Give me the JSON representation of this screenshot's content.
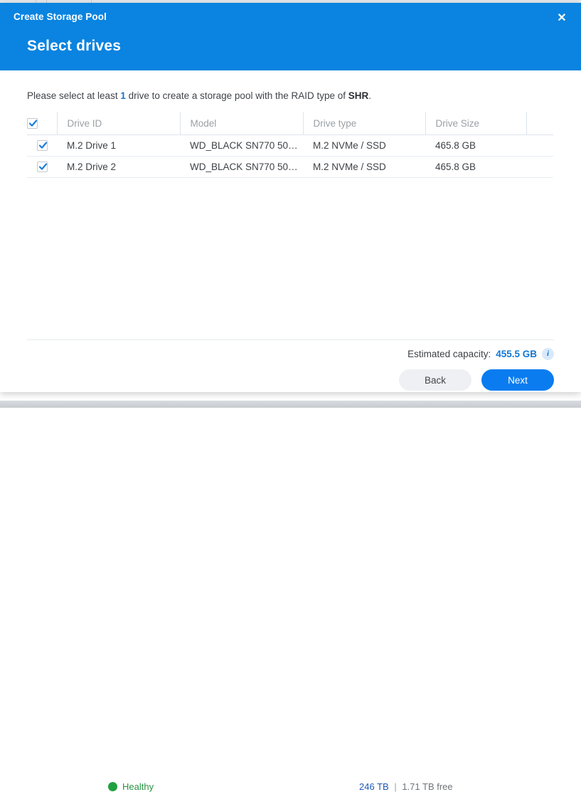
{
  "background": {
    "health_status": "Healthy",
    "capacity_used": "246 TB",
    "capacity_separator": "|",
    "capacity_free": "1.71 TB free"
  },
  "dialog": {
    "title": "Create Storage Pool",
    "subtitle": "Select drives",
    "close_label": "✕",
    "instruction": {
      "prefix": "Please select at least ",
      "min_drives": "1",
      "middle": " drive to create a storage pool with the RAID type of ",
      "raid_type": "SHR",
      "suffix": "."
    },
    "table": {
      "columns": [
        "Drive ID",
        "Model",
        "Drive type",
        "Drive Size"
      ],
      "header_checkbox_checked": true,
      "rows": [
        {
          "checked": true,
          "drive_id": "M.2 Drive 1",
          "model": "WD_BLACK SN770 50…",
          "drive_type": "M.2 NVMe / SSD",
          "drive_size": "465.8 GB"
        },
        {
          "checked": true,
          "drive_id": "M.2 Drive 2",
          "model": "WD_BLACK SN770 50…",
          "drive_type": "M.2 NVMe / SSD",
          "drive_size": "465.8 GB"
        }
      ]
    },
    "footer": {
      "estimated_label": "Estimated capacity:",
      "estimated_value": "455.5 GB",
      "info_glyph": "i",
      "back_label": "Back",
      "next_label": "Next"
    }
  },
  "colors": {
    "header_blue": "#0a84e0",
    "accent_blue": "#1277d4",
    "primary_button": "#0a7cf0",
    "healthy_green": "#21a040"
  }
}
